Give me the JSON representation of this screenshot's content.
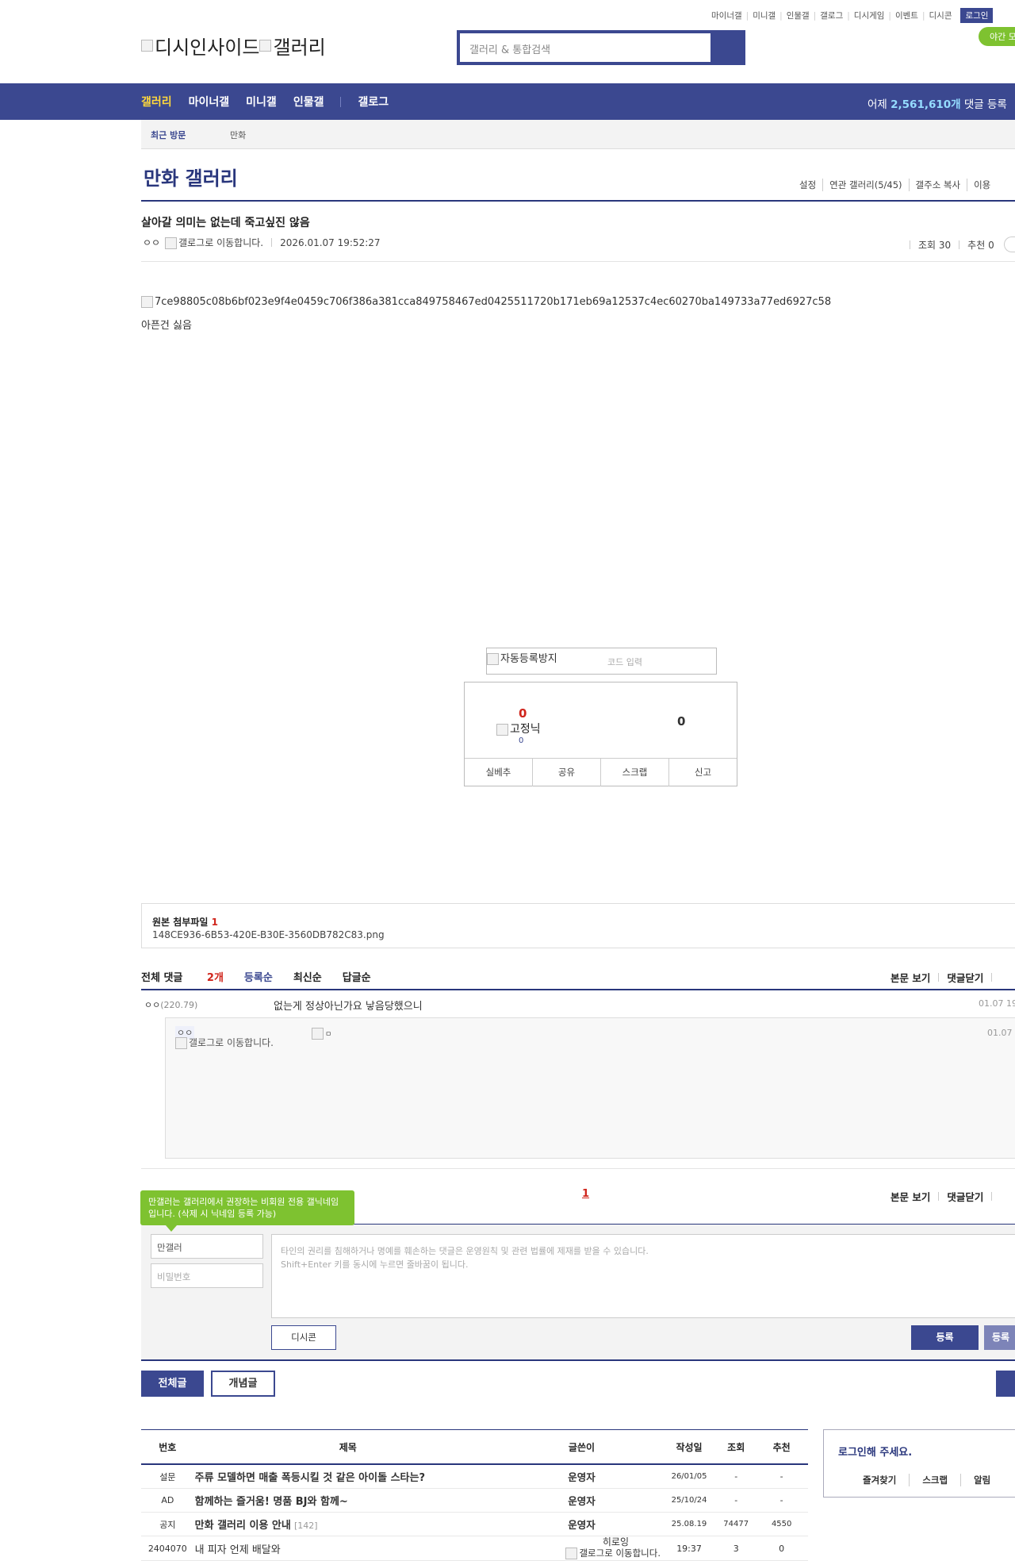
{
  "top_links": [
    "마이너갤",
    "미니갤",
    "인물갤",
    "갤로그",
    "디시게임",
    "이벤트",
    "디시콘"
  ],
  "login_label": "로그인",
  "night_mode_label": "야간 모",
  "logo": {
    "site": "디시인사이드",
    "gallery": "갤러리"
  },
  "search": {
    "placeholder": "갤러리 & 통합검색"
  },
  "nav": {
    "items": [
      "갤러리",
      "마이너갤",
      "미니갤",
      "인물갤",
      "갤로그"
    ],
    "stat_prefix": "어제",
    "stat_value": "2,561,610개",
    "stat_suffix": "댓글 등록"
  },
  "recent": {
    "label": "최근 방문",
    "items": [
      "만화"
    ]
  },
  "gallery": {
    "title": "만화 갤러리",
    "menu": [
      "설정",
      "연관 갤러리(5/45)",
      "갤주소 복사",
      "이용"
    ]
  },
  "post": {
    "title": "살아갈 의미는 없는데 죽고싶진 않음",
    "author": "ㅇㅇ",
    "gallog_alt": "갤로그로 이동합니다.",
    "date": "2026.01.07 19:52:27",
    "views_label": "조회 30",
    "recommend_label": "추천 0",
    "image_alt": "7ce98805c08b6bf023e9f4e0459c706f386a381cca849758467ed0425511720b171eb69a12537c4ec60270ba149733a77ed6927c58",
    "body": "아픈건 싫음"
  },
  "captcha": {
    "image_alt": "자동등록방지",
    "placeholder": "코드 입력"
  },
  "recommend": {
    "up": "0",
    "fixed_alt": "고정닉",
    "fixed_count": "0",
    "down": "0",
    "buttons": [
      "실베추",
      "공유",
      "스크랩",
      "신고"
    ]
  },
  "attachment": {
    "label": "원본 첨부파일",
    "count": "1",
    "file": "148CE936-6B53-420E-B30E-3560DB782C83.png"
  },
  "comments": {
    "total_label": "전체 댓글",
    "total_count": "2개",
    "sort": [
      "등록순",
      "최신순",
      "답글순"
    ],
    "right_links": [
      "본문 보기",
      "댓글닫기"
    ],
    "items": [
      {
        "name": "ㅇㅇ",
        "ip": "(220.79)",
        "text": "없는게 정상아닌가요 낳음당했으니",
        "date": "01.07 19"
      }
    ],
    "reply": {
      "name": "ㅇㅇ",
      "gallog_alt": "갤로그로 이동합니다.",
      "dccon_alt": "ㅁ",
      "date": "01.07 1"
    },
    "page": "1"
  },
  "write": {
    "tooltip": "만갤러는 갤러리에서 권장하는 비회원 전용 갤닉네임입니다. (삭제 시 닉네임 등록 가능)",
    "nickname_value": "만갤러",
    "password_placeholder": "비밀번호",
    "textarea_placeholder_1": "타인의 권리를 침해하거나 명예를 훼손하는 댓글은 운영원칙 및 관련 법률에 제재를 받을 수 있습니다.",
    "textarea_placeholder_2": "Shift+Enter 키를 동시에 누르면 줄바꿈이 됩니다.",
    "dccon_label": "디시콘",
    "register_label": "등록",
    "register2_label": "등록"
  },
  "list_buttons": {
    "all": "전체글",
    "concept": "개념글"
  },
  "list": {
    "headers": [
      "번호",
      "제목",
      "글쓴이",
      "작성일",
      "조회",
      "추천"
    ],
    "rows": [
      {
        "num": "설문",
        "title": "주류 모델하면 매출 폭등시킬 것 같은 아이돌 스타는?",
        "replies": "",
        "writer": "운영자",
        "date": "26/01/05",
        "views": "-",
        "rec": "-"
      },
      {
        "num": "AD",
        "title": "함께하는 즐거움! 명품 BJ와 함께~",
        "replies": "",
        "writer": "운영자",
        "date": "25/10/24",
        "views": "-",
        "rec": "-"
      },
      {
        "num": "공지",
        "title": "만화 갤러리 이용 안내",
        "replies": "[142]",
        "writer": "운영자",
        "date": "25.08.19",
        "views": "74477",
        "rec": "4550"
      },
      {
        "num": "2404070",
        "title": "내 피자 언제 배달와",
        "replies": "",
        "writer": "히로잉",
        "writer_gallog": "갤로그로 이동합니다.",
        "date": "19:37",
        "views": "3",
        "rec": "0"
      }
    ]
  },
  "login_box": {
    "title": "로그인해 주세요.",
    "links": [
      "즐겨찾기",
      "스크랩",
      "알림"
    ]
  }
}
